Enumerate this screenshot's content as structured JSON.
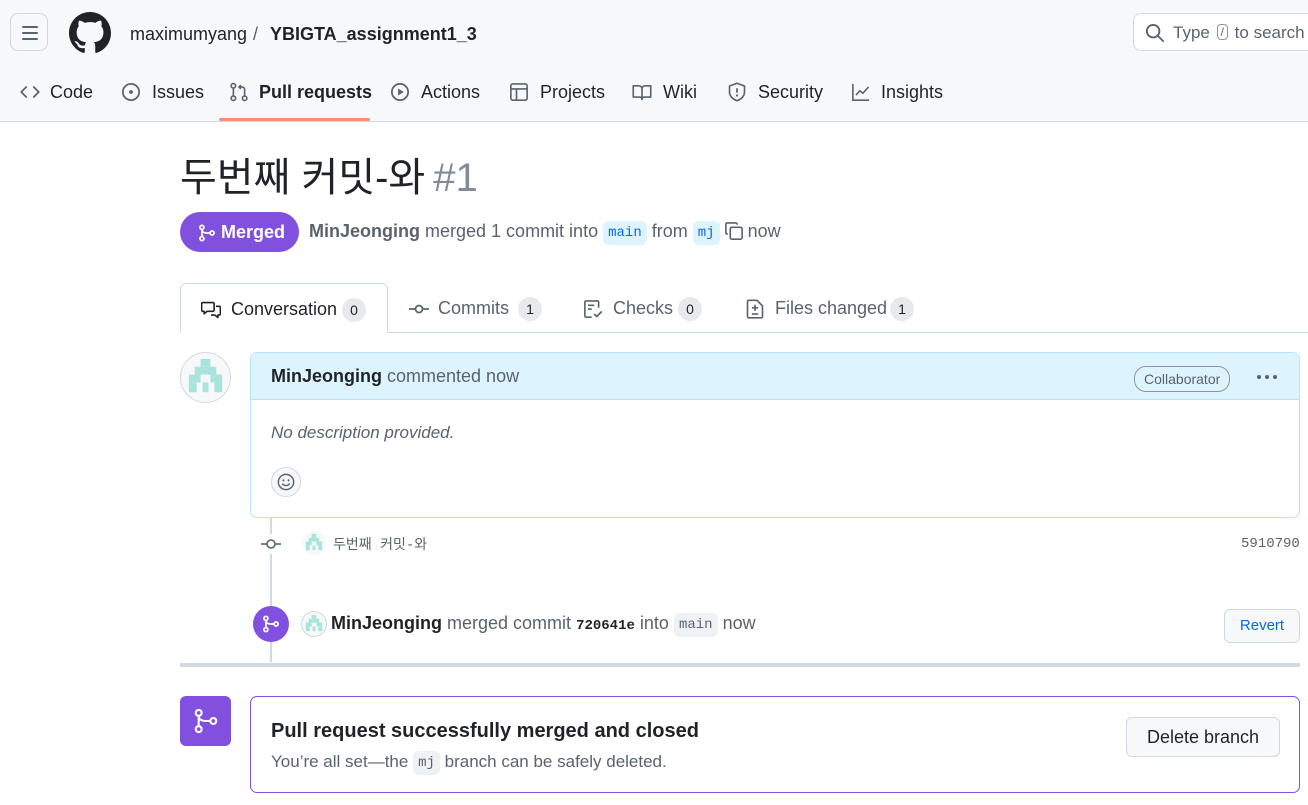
{
  "header": {
    "owner": "maximumyang",
    "separator": "/",
    "repo": "YBIGTA_assignment1_3",
    "search": {
      "before": "Type",
      "key": "/",
      "after": "to search"
    }
  },
  "repo_tabs": [
    {
      "label": "Code",
      "icon": "code-icon"
    },
    {
      "label": "Issues",
      "icon": "issue-icon"
    },
    {
      "label": "Pull requests",
      "icon": "pull-request-icon",
      "active": true
    },
    {
      "label": "Actions",
      "icon": "play-icon"
    },
    {
      "label": "Projects",
      "icon": "table-icon"
    },
    {
      "label": "Wiki",
      "icon": "book-icon"
    },
    {
      "label": "Security",
      "icon": "shield-icon"
    },
    {
      "label": "Insights",
      "icon": "graph-icon"
    }
  ],
  "pr": {
    "title": "두번째 커밋-와",
    "number": "#1",
    "state": "Merged",
    "author": "MinJeonging",
    "meta_action": "merged 1 commit into",
    "base_branch": "main",
    "meta_from": "from",
    "head_branch": "mj",
    "meta_time": "now"
  },
  "pr_tabs": [
    {
      "label": "Conversation",
      "count": "0",
      "icon": "comment-discussion-icon"
    },
    {
      "label": "Commits",
      "count": "1",
      "icon": "commit-icon"
    },
    {
      "label": "Checks",
      "count": "0",
      "icon": "checklist-icon"
    },
    {
      "label": "Files changed",
      "count": "1",
      "icon": "diff-icon"
    }
  ],
  "comment": {
    "author": "MinJeonging",
    "action": "commented now",
    "role": "Collaborator",
    "body": "No description provided."
  },
  "commit": {
    "message": "두번째 커밋-와",
    "sha": "5910790"
  },
  "merge_event": {
    "author": "MinJeonging",
    "text1": "merged commit",
    "sha": "720641e",
    "text2": "into",
    "branch": "main",
    "time": "now",
    "revert_label": "Revert"
  },
  "status": {
    "title": "Pull request successfully merged and closed",
    "sub_before": "You’re all set—the",
    "branch": "mj",
    "sub_after": "branch can be safely deleted.",
    "delete_label": "Delete branch"
  },
  "colors": {
    "merged": "#8250df",
    "accent_underline": "#fd8c73",
    "link": "#0969da",
    "comment_header_bg": "#ddf4ff"
  }
}
